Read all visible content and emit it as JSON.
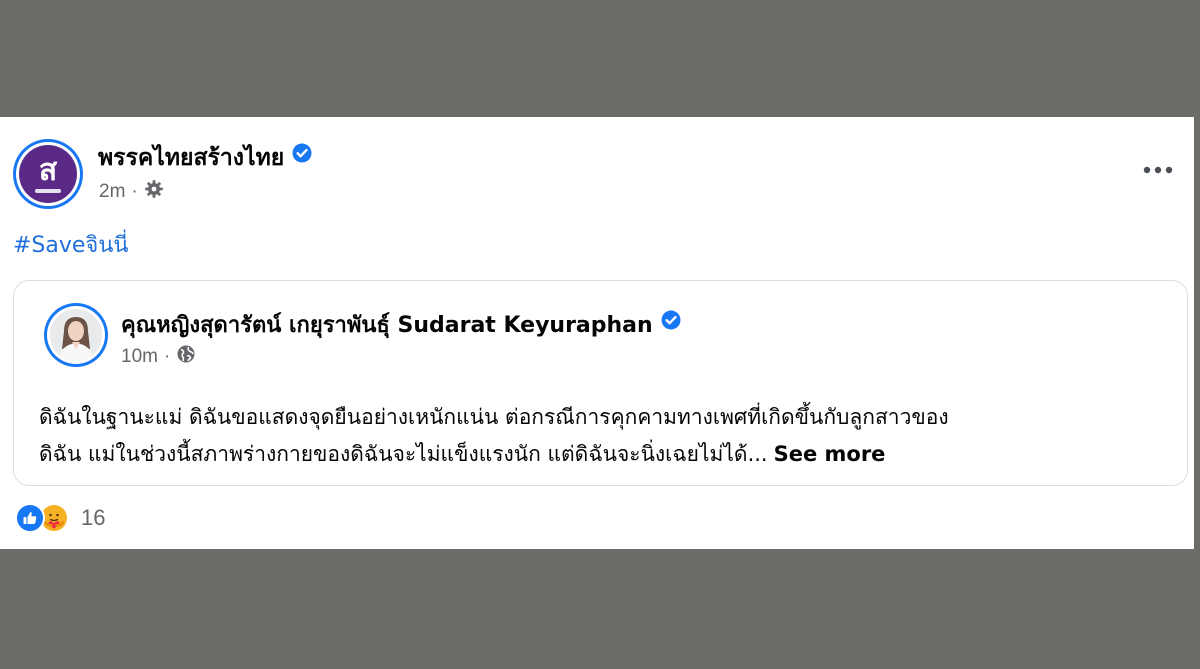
{
  "post": {
    "page_name": "พรรคไทยสร้างไทย",
    "timestamp": "2m",
    "separator": "·",
    "hashtag": "#Saveจินนี่",
    "more_icon": "ellipsis-icon",
    "audience_icon": "gear-icon"
  },
  "shared_post": {
    "author": "คุณหญิงสุดารัตน์ เกยุราพันธุ์ Sudarat Keyuraphan",
    "timestamp": "10m",
    "separator": "·",
    "audience_icon": "globe-icon",
    "text_line1": "ดิฉันในฐานะแม่ ดิฉันขอแสดงจุดยืนอย่างเหนักแน่น ต่อกรณีการคุกคามทางเพศที่เกิดขึ้นกับลูกสาวของ",
    "text_line2": "ดิฉัน แม่ในช่วงนี้สภาพร่างกายของดิฉันจะไม่แข็งแรงนัก แต่ดิฉันจะนิ่งเฉยไม่ได้...",
    "see_more": "See more"
  },
  "reactions": {
    "count": "16",
    "types": [
      "like",
      "care"
    ]
  },
  "colors": {
    "background": "#6b6b68",
    "card": "#ffffff",
    "brand_blue": "#1877f2",
    "hashtag": "#216fdb",
    "secondary_text": "#65676b",
    "party_purple": "#5b2a86"
  }
}
